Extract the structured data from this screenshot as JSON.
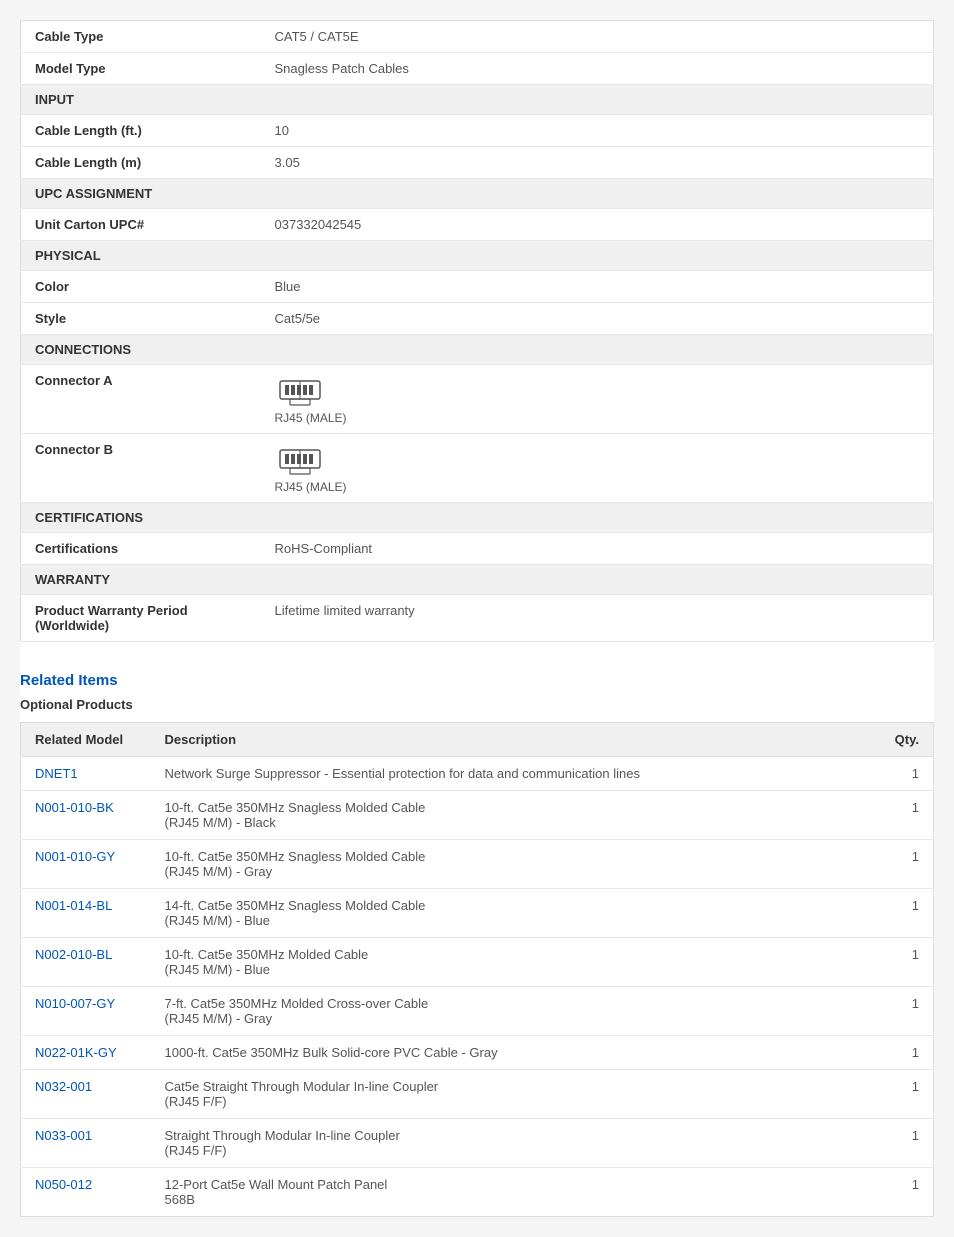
{
  "specs": {
    "rows": [
      {
        "type": "data",
        "label": "Cable Type",
        "value": "CAT5 / CAT5E"
      },
      {
        "type": "data",
        "label": "Model Type",
        "value": "Snagless Patch Cables"
      },
      {
        "type": "section",
        "label": "INPUT"
      },
      {
        "type": "data",
        "label": "Cable Length (ft.)",
        "value": "10"
      },
      {
        "type": "data",
        "label": "Cable Length (m)",
        "value": "3.05"
      },
      {
        "type": "section",
        "label": "UPC ASSIGNMENT"
      },
      {
        "type": "data",
        "label": "Unit Carton UPC#",
        "value": "037332042545"
      },
      {
        "type": "section",
        "label": "PHYSICAL"
      },
      {
        "type": "data",
        "label": "Color",
        "value": "Blue"
      },
      {
        "type": "data",
        "label": "Style",
        "value": "Cat5/5e"
      },
      {
        "type": "section",
        "label": "CONNECTIONS"
      },
      {
        "type": "connector",
        "label": "Connector A",
        "value": "RJ45 (MALE)"
      },
      {
        "type": "connector",
        "label": "Connector B",
        "value": "RJ45 (MALE)"
      },
      {
        "type": "section",
        "label": "CERTIFICATIONS"
      },
      {
        "type": "data",
        "label": "Certifications",
        "value": "RoHS-Compliant"
      },
      {
        "type": "section",
        "label": "WARRANTY"
      },
      {
        "type": "data",
        "label": "Product Warranty Period (Worldwide)",
        "value": "Lifetime limited warranty"
      }
    ]
  },
  "related": {
    "title": "Related Items",
    "optional_label": "Optional Products",
    "table_headers": {
      "model": "Related Model",
      "description": "Description",
      "qty": "Qty."
    },
    "items": [
      {
        "model": "DNET1",
        "description": "Network Surge Suppressor - Essential protection for data and communication lines",
        "qty": "1"
      },
      {
        "model": "N001-010-BK",
        "description": "10-ft. Cat5e 350MHz Snagless Molded Cable\n(RJ45 M/M) - Black",
        "qty": "1"
      },
      {
        "model": "N001-010-GY",
        "description": "10-ft. Cat5e 350MHz Snagless Molded Cable\n(RJ45 M/M) - Gray",
        "qty": "1"
      },
      {
        "model": "N001-014-BL",
        "description": "14-ft. Cat5e 350MHz Snagless Molded Cable\n(RJ45 M/M) - Blue",
        "qty": "1"
      },
      {
        "model": "N002-010-BL",
        "description": "10-ft. Cat5e 350MHz Molded Cable\n(RJ45 M/M) - Blue",
        "qty": "1"
      },
      {
        "model": "N010-007-GY",
        "description": "7-ft. Cat5e 350MHz Molded Cross-over Cable\n(RJ45 M/M) - Gray",
        "qty": "1"
      },
      {
        "model": "N022-01K-GY",
        "description": "1000-ft. Cat5e 350MHz Bulk Solid-core PVC Cable - Gray",
        "qty": "1"
      },
      {
        "model": "N032-001",
        "description": "Cat5e Straight Through Modular In-line Coupler\n(RJ45 F/F)",
        "qty": "1"
      },
      {
        "model": "N033-001",
        "description": "Straight Through Modular In-line Coupler\n(RJ45 F/F)",
        "qty": "1"
      },
      {
        "model": "N050-012",
        "description": "12-Port Cat5e Wall Mount Patch Panel\n568B",
        "qty": "1"
      }
    ]
  }
}
